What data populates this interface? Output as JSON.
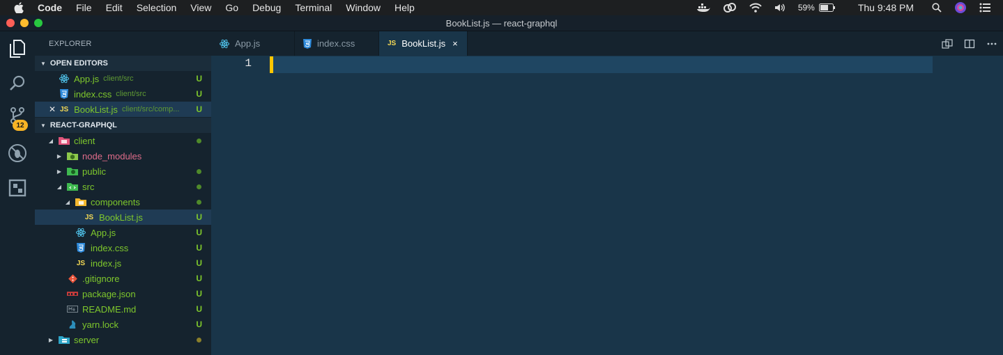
{
  "menubar": {
    "app": "Code",
    "items": [
      "File",
      "Edit",
      "Selection",
      "View",
      "Go",
      "Debug",
      "Terminal",
      "Window",
      "Help"
    ],
    "battery": "59%",
    "clock": "Thu 9:48 PM"
  },
  "window": {
    "title": "BookList.js — react-graphql"
  },
  "activity": {
    "scm_badge": "12"
  },
  "sidebar": {
    "title": "EXPLORER",
    "open_editors_label": "OPEN EDITORS",
    "open_editors": [
      {
        "name": "App.js",
        "path": "client/src",
        "status": "U",
        "icon": "react-icon"
      },
      {
        "name": "index.css",
        "path": "client/src",
        "status": "U",
        "icon": "css-icon"
      },
      {
        "name": "BookList.js",
        "path": "client/src/comp...",
        "status": "U",
        "icon": "js-icon"
      }
    ],
    "project_label": "REACT-GRAPHQL",
    "tree": [
      {
        "name": "client"
      },
      {
        "name": "node_modules"
      },
      {
        "name": "public"
      },
      {
        "name": "src"
      },
      {
        "name": "components"
      },
      {
        "name": "BookList.js",
        "status": "U"
      },
      {
        "name": "App.js",
        "status": "U"
      },
      {
        "name": "index.css",
        "status": "U"
      },
      {
        "name": "index.js",
        "status": "U"
      },
      {
        "name": ".gitignore",
        "status": "U"
      },
      {
        "name": "package.json",
        "status": "U"
      },
      {
        "name": "README.md",
        "status": "U"
      },
      {
        "name": "yarn.lock",
        "status": "U"
      },
      {
        "name": "server"
      }
    ]
  },
  "tabs": [
    {
      "label": "App.js",
      "icon": "react-icon"
    },
    {
      "label": "index.css",
      "icon": "css-icon"
    },
    {
      "label": "BookList.js",
      "icon": "js-icon",
      "close": "×"
    }
  ],
  "editor": {
    "line_number": "1"
  },
  "icons": {
    "js_text": "JS"
  },
  "colors": {
    "accent": "#ffc600",
    "editor_bg": "#193549",
    "untracked": "#7ec72c"
  }
}
